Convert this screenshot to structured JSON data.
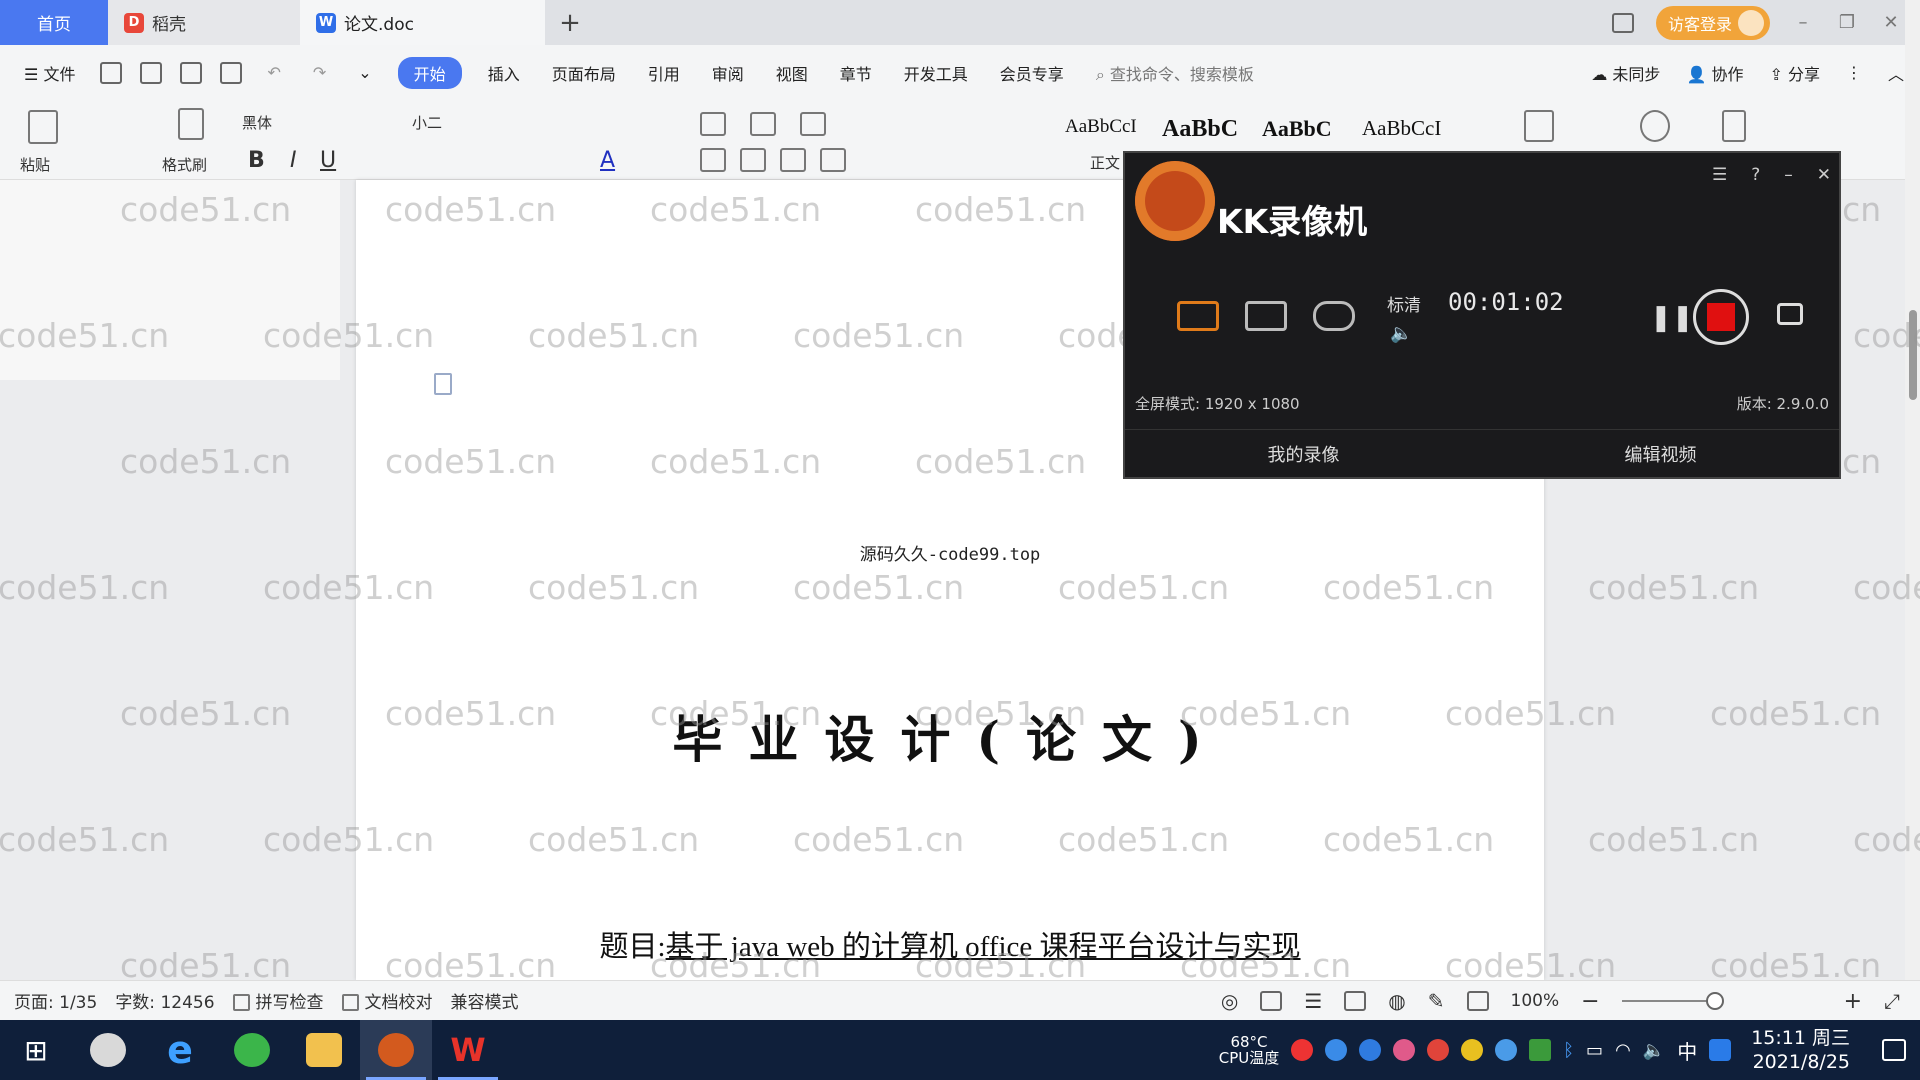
{
  "tabs": {
    "home": "首页",
    "daoke": "稻壳",
    "doc": "论文.doc",
    "add": "+"
  },
  "titlebar": {
    "login": "访客登录"
  },
  "menu": {
    "file": "文件",
    "items": [
      "开始",
      "插入",
      "页面布局",
      "引用",
      "审阅",
      "视图",
      "章节",
      "开发工具",
      "会员专享"
    ],
    "search_cmd": "查找命令、搜索模板",
    "sync": "未同步",
    "collab": "协作",
    "share": "分享"
  },
  "ribbon": {
    "paste": "粘贴",
    "format_painter": "格式刷",
    "font_name": "黑体",
    "font_size": "小二",
    "styles": [
      "AaBbCcI",
      "AaBbC",
      "AaBbC",
      "AaBbCcI"
    ],
    "style_normal": "正文"
  },
  "document": {
    "source_line": "源码久久-code99.top",
    "title": "毕业设计(论文)",
    "subject_label": "题目:",
    "subject_value": "基于 java web 的计算机 office 课程平台设计与实现"
  },
  "watermark": "code51.cn",
  "recorder": {
    "name": "KK录像机",
    "quality": "标清",
    "timer": "00:01:02",
    "mode": "全屏模式: 1920 x 1080",
    "version": "版本: 2.9.0.0",
    "my_videos": "我的录像",
    "edit_video": "编辑视频"
  },
  "status": {
    "page": "页面: 1/35",
    "word_count": "字数: 12456",
    "spell_check": "拼写检查",
    "doc_check": "文档校对",
    "compat": "兼容模式",
    "zoom": "100%"
  },
  "taskbar": {
    "cpu_temp": "68°C",
    "cpu_label": "CPU温度",
    "ime": "中",
    "time": "15:11 周三",
    "date": "2021/8/25"
  },
  "colors": {
    "accent": "#4a78f0",
    "record_red": "#e01010",
    "taskbar": "#0f1f3a"
  }
}
